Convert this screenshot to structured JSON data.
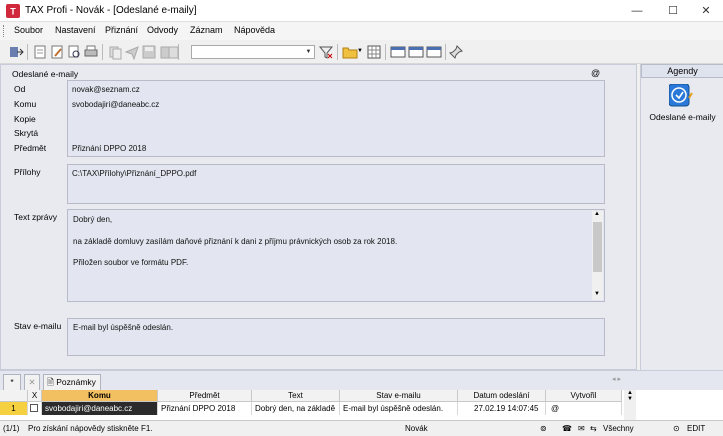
{
  "window": {
    "title": "TAX Profi - Novák - [Odeslané e-maily]",
    "minimize": "—",
    "maximize": "☐",
    "close": "✕"
  },
  "menu": [
    "Soubor",
    "Nastavení",
    "Přiznání",
    "Odvody",
    "Záznam",
    "Nápověda"
  ],
  "main": {
    "section_title": "Odeslané e-maily",
    "at_icon": "@",
    "fields": {
      "od_label": "Od",
      "od_value": "novak@seznam.cz",
      "komu_label": "Komu",
      "komu_value": "svobodajiri@daneabc.cz",
      "kopie_label": "Kopie",
      "kopie_value": "",
      "skryta_label": "Skrytá",
      "skryta_value": "",
      "predmet_label": "Předmět",
      "predmet_value": "Přiznání DPPO 2018"
    },
    "prilohy_label": "Přílohy",
    "prilohy_value": "C:\\TAX\\Přílohy\\Přiznání_DPPO.pdf",
    "text_label": "Text zprávy",
    "text_lines": [
      "Dobrý den,",
      "na základě domluvy zasílám daňové přiznání k dani z příjmu právnických osob za rok 2018.",
      "Přiložen soubor ve formátu PDF."
    ],
    "stav_label": "Stav e-mailu",
    "stav_value": "E-mail byl úspěšně odeslán."
  },
  "agendy": {
    "header": "Agendy",
    "item_label": "Odeslané e-maily"
  },
  "tabs": {
    "star": "*",
    "notes": "Poznámky"
  },
  "grid": {
    "headers": [
      "",
      "X",
      "Komu",
      "Předmět",
      "Text",
      "Stav e-mailu",
      "Datum odeslání",
      "Vytvořil"
    ],
    "row": {
      "num": "1",
      "komu": "svobodajiri@daneabc.cz",
      "predmet": "Přiznání DPPO 2018",
      "text": "Dobrý den, na základě",
      "stav": "E-mail byl úspěšně odeslán.",
      "datum": "27.02.19 14:07:45",
      "vytvoril": "@"
    }
  },
  "status": {
    "count": "(1/1)",
    "hint": "Pro získání nápovědy stiskněte F1.",
    "user": "Novák",
    "filter": "Všechny",
    "mode": "EDIT"
  },
  "colors": {
    "accent": "#1e6fd0",
    "selected_cell": "#2b2b2b",
    "header_highlight": "#f2c060",
    "row_number": "#f5d040"
  }
}
